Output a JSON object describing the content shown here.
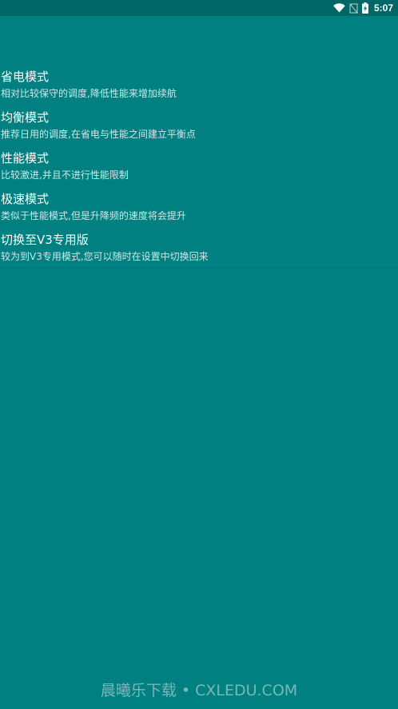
{
  "status_bar": {
    "time": "5:07",
    "icons": [
      "wifi-icon",
      "no-sim-icon",
      "battery-charging-icon"
    ]
  },
  "modes": [
    {
      "title": "省电模式",
      "desc": "相对比较保守的调度,降低性能来增加续航"
    },
    {
      "title": "均衡模式",
      "desc": "推荐日用的调度,在省电与性能之间建立平衡点"
    },
    {
      "title": "性能模式",
      "desc": "比较激进,并且不进行性能限制"
    },
    {
      "title": "极速模式",
      "desc": "类似于性能模式,但是升降频的速度将会提升"
    },
    {
      "title": "切换至V3专用版",
      "desc": "较为到V3专用模式,您可以随时在设置中切换回来"
    }
  ],
  "watermark": "晨曦乐下载 • CXLEDU.COM",
  "colors": {
    "background": "#008080",
    "status_bar": "#006666"
  }
}
